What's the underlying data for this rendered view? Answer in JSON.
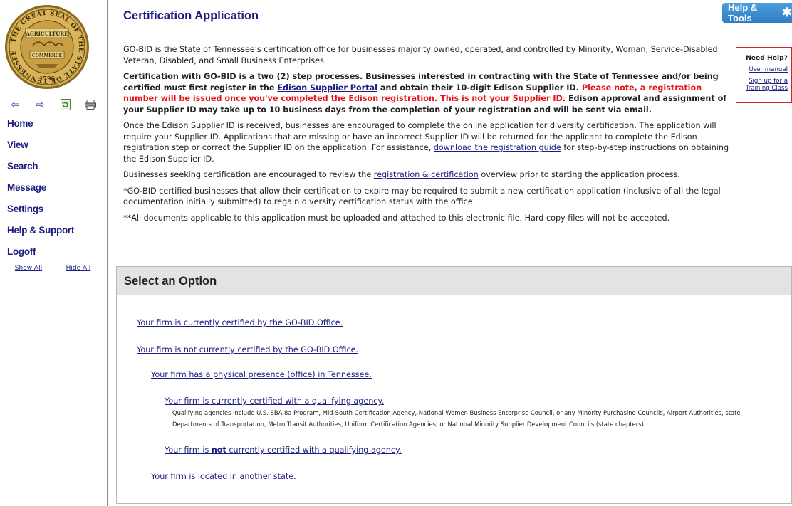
{
  "sidebar": {
    "seal_text_top": "THE GREAT SEAL OF THE STATE OF TENNESSEE",
    "seal_word_1": "AGRICULTURE",
    "seal_word_2": "COMMERCE",
    "seal_year": "1796",
    "nav_icons": [
      "back-arrow-icon",
      "forward-arrow-icon",
      "refresh-icon",
      "print-icon"
    ],
    "menu": [
      "Home",
      "View",
      "Search",
      "Message",
      "Settings",
      "Help & Support",
      "Logoff"
    ],
    "show_all": "Show All",
    "hide_all": "Hide All"
  },
  "header": {
    "title": "Certification Application",
    "help_tools": "Help & Tools"
  },
  "intro": {
    "p1": "GO-BID is the State of Tennessee's certification office for businesses majority owned, operated, and controlled by Minority, Woman, Service-Disabled Veteran, Disabled, and Small Business Enterprises.",
    "p2_a": "Certification with GO-BID is a two (2) step processes. Businesses interested in contracting with the State of Tennessee and/or being certified must first register in the ",
    "p2_link": "Edison Supplier Portal",
    "p2_b": " and obtain their 10-digit Edison Supplier ID. ",
    "p2_red": "Please note, a registration number will be issued once you've completed the Edison registration. This is not your Supplier ID.",
    "p2_c": " Edison approval and assignment of your Supplier ID may take up to 10 business days from the completion of your registration and will be sent via email.",
    "p3_a": "Once the Edison Supplier ID is received, businesses are encouraged to complete the online application for diversity certification. The application will require your Supplier ID. Applications that are missing or have an incorrect Supplier ID will be returned for the applicant to complete the Edison registration step or correct the Supplier ID on the application. For assistance, ",
    "p3_link": "download the registration guide",
    "p3_b": " for step-by-step instructions on obtaining the Edison Supplier ID.",
    "p4_a": "Businesses seeking certification are encouraged to review the ",
    "p4_link": "registration & certification",
    "p4_b": " overview prior to starting the application process.",
    "p5": "*GO-BID certified businesses that allow their certification to expire may be required to submit a new certification application (inclusive of all the legal documentation initially submitted) to regain diversity certification status with the office.",
    "p6": "**All documents applicable to this application must be uploaded and attached to this electronic file. Hard copy files will not be accepted."
  },
  "need_help": {
    "title": "Need Help?",
    "manual": "User manual",
    "training": "Sign up for a Training Class"
  },
  "options": {
    "heading": "Select an Option",
    "opt1": "Your firm is currently certified by the GO-BID Office.",
    "opt2": "Your firm is not currently certified by the GO-BID Office.",
    "opt3": "Your firm has a physical presence (office) in Tennessee.",
    "opt4": "Your firm is currently certified with a qualifying agency.",
    "opt4_note": "Qualifying agencies include U.S. SBA 8a Program, Mid-South Certification Agency, National Women Business Enterprise Council, or any Minority Purchasing Councils, Airport Authorities, state Departments of Transportation, Metro Transit Authorities, Uniform Certification Agencies, or National Minority Supplier Development Councils (state chapters).",
    "opt5_a": "Your firm is ",
    "opt5_b": "not",
    "opt5_c": " currently certified with a qualifying agency.",
    "opt6": "Your firm is located in another state."
  }
}
